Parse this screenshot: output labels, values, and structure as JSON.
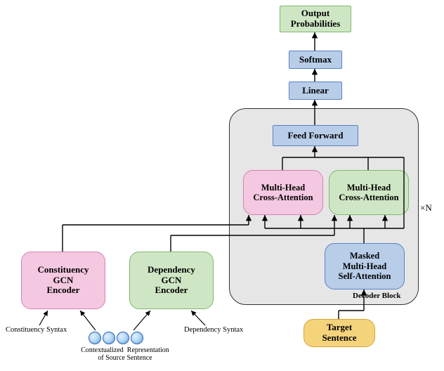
{
  "blocks": {
    "output": "Output\nProbabilities",
    "softmax": "Softmax",
    "linear": "Linear",
    "feed_forward": "Feed Forward",
    "cross_attn_left": "Multi-Head\nCross-Attention",
    "cross_attn_right": "Multi-Head\nCross-Attention",
    "masked_self_attn": "Masked\nMulti-Head\nSelf-Attention",
    "decoder_label": "Decoder Block",
    "times_n": "×N",
    "constituency_encoder": "Constituency\nGCN\nEncoder",
    "dependency_encoder": "Dependency\nGCN\nEncoder",
    "target": "Target\nSentence"
  },
  "labels": {
    "constituency_syntax": "Constituency Syntax",
    "dependency_syntax": "Dependency Syntax",
    "context_repr": "Contextualized  Representation\nof Source Sentence"
  }
}
